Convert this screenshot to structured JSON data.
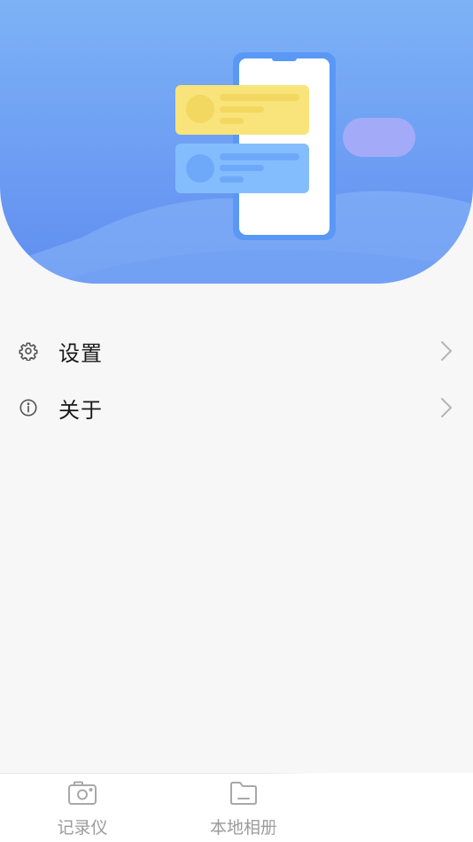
{
  "banner": {
    "illustration": "phone-with-message-bubbles-illustration",
    "colors": {
      "background_top": "#7db2f6",
      "background_bottom": "#5f8ef0",
      "phone_frame": "#5a98f6",
      "yellow_card": "#f8e47a",
      "blue_card": "#84bdfd",
      "purple_pill": "#a3abf8"
    }
  },
  "menu": {
    "items": [
      {
        "icon": "gear-icon",
        "label": "设置"
      },
      {
        "icon": "info-icon",
        "label": "关于"
      }
    ]
  },
  "bottom_nav": {
    "tabs": [
      {
        "icon": "camera-icon",
        "label": "记录仪"
      },
      {
        "icon": "folder-icon",
        "label": "本地相册"
      }
    ]
  }
}
